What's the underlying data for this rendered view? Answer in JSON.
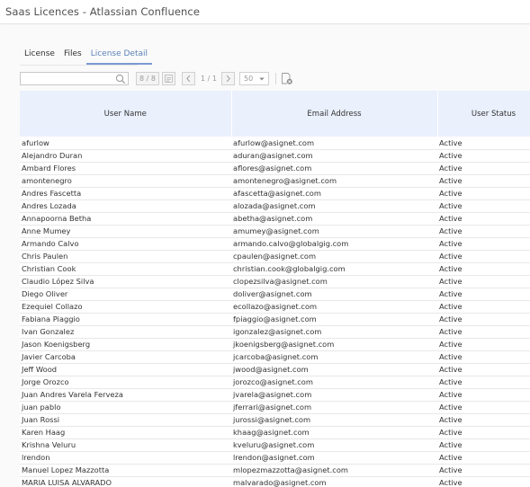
{
  "header": {
    "title": "Saas Licences - Atlassian Confluence"
  },
  "tabs": [
    {
      "label": "License",
      "active": false
    },
    {
      "label": "Files",
      "active": false
    },
    {
      "label": "License Detail",
      "active": true
    }
  ],
  "toolbar": {
    "search_value": "",
    "record_count": "8 / 8",
    "page_indicator": "1 / 1",
    "page_size": "50",
    "icons": [
      "search-icon",
      "export-icon",
      "prev-page-icon",
      "next-page-icon",
      "chevron-down-icon",
      "clear-filter-icon"
    ]
  },
  "colors": {
    "accent": "#5c82b8",
    "header_bg": "#eaf0fc"
  },
  "table": {
    "columns": [
      "User Name",
      "Email Address",
      "User Status"
    ],
    "rows": [
      [
        "afurlow",
        "afurlow@asignet.com",
        "Active"
      ],
      [
        "Alejandro Duran",
        "aduran@asignet.com",
        "Active"
      ],
      [
        "Ambard Flores",
        "aflores@asignet.com",
        "Active"
      ],
      [
        "amontenegro",
        "amontenegro@asignet.com",
        "Active"
      ],
      [
        "Andres Fascetta",
        "afascetta@asignet.com",
        "Active"
      ],
      [
        "Andres Lozada",
        "alozada@asignet.com",
        "Active"
      ],
      [
        "Annapoorna Betha",
        "abetha@asignet.com",
        "Active"
      ],
      [
        "Anne Mumey",
        "amumey@asignet.com",
        "Active"
      ],
      [
        "Armando Calvo",
        "armando.calvo@globalgig.com",
        "Active"
      ],
      [
        "Chris Paulen",
        "cpaulen@asignet.com",
        "Active"
      ],
      [
        "Christian Cook",
        "christian.cook@globalgig.com",
        "Active"
      ],
      [
        "Claudio López Silva",
        "clopezsilva@asignet.com",
        "Active"
      ],
      [
        "Diego Oliver",
        "doliver@asignet.com",
        "Active"
      ],
      [
        "Ezequiel Collazo",
        "ecollazo@asignet.com",
        "Active"
      ],
      [
        "Fabiana Piaggio",
        "fpiaggio@asignet.com",
        "Active"
      ],
      [
        "Ivan Gonzalez",
        "igonzalez@asignet.com",
        "Active"
      ],
      [
        "Jason Koenigsberg",
        "jkoenigsberg@asignet.com",
        "Active"
      ],
      [
        "Javier Carcoba",
        "jcarcoba@asignet.com",
        "Active"
      ],
      [
        "Jeff Wood",
        "jwood@asignet.com",
        "Active"
      ],
      [
        "Jorge Orozco",
        "jorozco@asignet.com",
        "Active"
      ],
      [
        "Juan Andres Varela Ferveza",
        "jvarela@asignet.com",
        "Active"
      ],
      [
        "juan pablo",
        "jferrari@asignet.com",
        "Active"
      ],
      [
        "Juan Rossi",
        "jurossi@asignet.com",
        "Active"
      ],
      [
        "Karen Haag",
        "khaag@asignet.com",
        "Active"
      ],
      [
        "Krishna Veluru",
        "kveluru@asignet.com",
        "Active"
      ],
      [
        "lrendon",
        "lrendon@asignet.com",
        "Active"
      ],
      [
        "Manuel Lopez Mazzotta",
        "mlopezmazzotta@asignet.com",
        "Active"
      ],
      [
        "MARIA LUISA ALVARADO",
        "malvarado@asignet.com",
        "Active"
      ]
    ]
  }
}
